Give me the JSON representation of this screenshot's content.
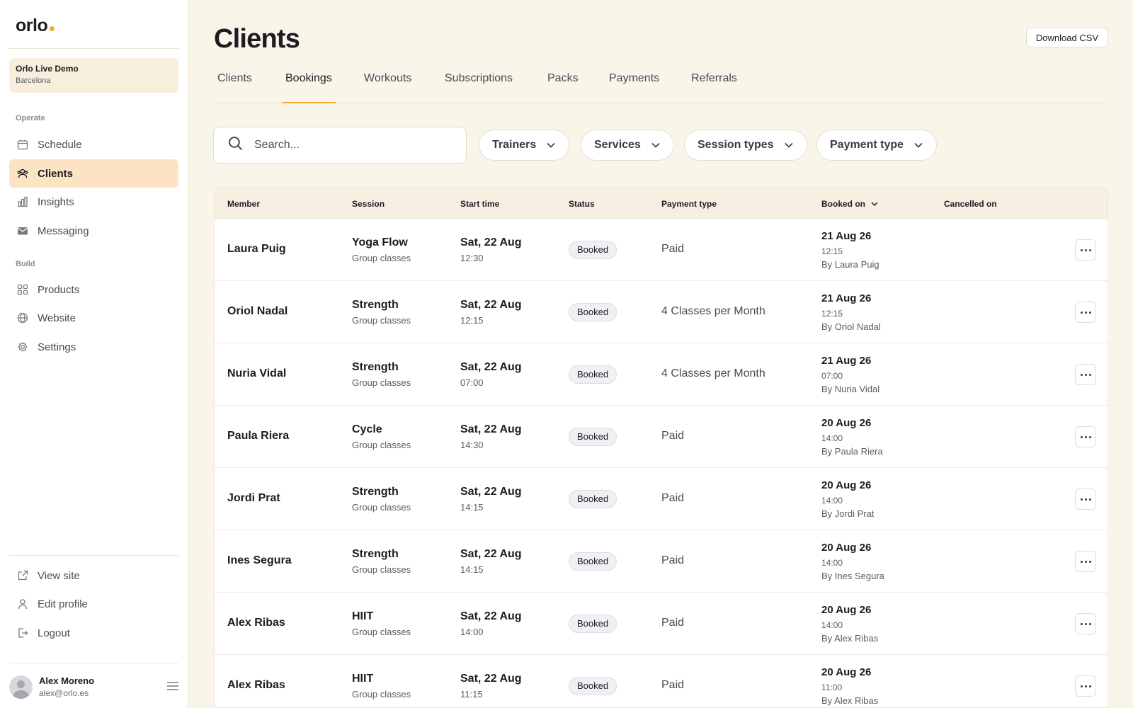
{
  "sidebar": {
    "logo": "orlo",
    "org": {
      "name": "Orlo Live Demo",
      "city": "Barcelona"
    },
    "sections": {
      "operate": "Operate",
      "build": "Build"
    },
    "nav": [
      {
        "label": "Schedule",
        "icon": "calendar-icon"
      },
      {
        "label": "Clients",
        "icon": "users-icon",
        "active": true
      },
      {
        "label": "Insights",
        "icon": "bar-chart-icon"
      },
      {
        "label": "Messaging",
        "icon": "envelope-icon"
      },
      {
        "label": "Products",
        "icon": "grid-icon"
      },
      {
        "label": "Website",
        "icon": "globe-icon"
      },
      {
        "label": "Settings",
        "icon": "gear-icon"
      }
    ],
    "footer": [
      {
        "label": "View site",
        "icon": "external-link-icon"
      },
      {
        "label": "Edit profile",
        "icon": "user-icon"
      },
      {
        "label": "Logout",
        "icon": "logout-icon"
      }
    ],
    "user": {
      "name": "Alex Moreno",
      "email": "alex@orlo.es"
    }
  },
  "header": {
    "title": "Clients",
    "download_label": "Download CSV"
  },
  "tabs": [
    "Clients",
    "Bookings",
    "Workouts",
    "Subscriptions",
    "Packs",
    "Payments",
    "Referrals"
  ],
  "active_tab": "Bookings",
  "search": {
    "placeholder": "Search..."
  },
  "filters": [
    "Trainers",
    "Services",
    "Session types",
    "Payment type"
  ],
  "table": {
    "columns": [
      "Member",
      "Session",
      "Start time",
      "Status",
      "Payment type",
      "Booked on",
      "Cancelled on"
    ],
    "sorted_column": "Booked on",
    "rows": [
      {
        "member": "Laura Puig",
        "session": "Yoga Flow",
        "session_type": "Group classes",
        "start_date": "Sat, 22 Aug",
        "start_time": "12:30",
        "status": "Booked",
        "payment": "Paid",
        "booked_date": "21 Aug 26",
        "booked_time": "12:15",
        "booked_by": "By Laura Puig",
        "cancelled": ""
      },
      {
        "member": "Oriol Nadal",
        "session": "Strength",
        "session_type": "Group classes",
        "start_date": "Sat, 22 Aug",
        "start_time": "12:15",
        "status": "Booked",
        "payment": "4 Classes per Month",
        "booked_date": "21 Aug 26",
        "booked_time": "12:15",
        "booked_by": "By Oriol Nadal",
        "cancelled": ""
      },
      {
        "member": "Nuria Vidal",
        "session": "Strength",
        "session_type": "Group classes",
        "start_date": "Sat, 22 Aug",
        "start_time": "07:00",
        "status": "Booked",
        "payment": "4 Classes per Month",
        "booked_date": "21 Aug 26",
        "booked_time": "07:00",
        "booked_by": "By Nuria Vidal",
        "cancelled": ""
      },
      {
        "member": "Paula Riera",
        "session": "Cycle",
        "session_type": "Group classes",
        "start_date": "Sat, 22 Aug",
        "start_time": "14:30",
        "status": "Booked",
        "payment": "Paid",
        "booked_date": "20 Aug 26",
        "booked_time": "14:00",
        "booked_by": "By Paula Riera",
        "cancelled": ""
      },
      {
        "member": "Jordi Prat",
        "session": "Strength",
        "session_type": "Group classes",
        "start_date": "Sat, 22 Aug",
        "start_time": "14:15",
        "status": "Booked",
        "payment": "Paid",
        "booked_date": "20 Aug 26",
        "booked_time": "14:00",
        "booked_by": "By Jordi Prat",
        "cancelled": ""
      },
      {
        "member": "Ines Segura",
        "session": "Strength",
        "session_type": "Group classes",
        "start_date": "Sat, 22 Aug",
        "start_time": "14:15",
        "status": "Booked",
        "payment": "Paid",
        "booked_date": "20 Aug 26",
        "booked_time": "14:00",
        "booked_by": "By Ines Segura",
        "cancelled": ""
      },
      {
        "member": "Alex Ribas",
        "session": "HIIT",
        "session_type": "Group classes",
        "start_date": "Sat, 22 Aug",
        "start_time": "14:00",
        "status": "Booked",
        "payment": "Paid",
        "booked_date": "20 Aug 26",
        "booked_time": "14:00",
        "booked_by": "By Alex Ribas",
        "cancelled": ""
      },
      {
        "member": "Alex Ribas",
        "session": "HIIT",
        "session_type": "Group classes",
        "start_date": "Sat, 22 Aug",
        "start_time": "11:15",
        "status": "Booked",
        "payment": "Paid",
        "booked_date": "20 Aug 26",
        "booked_time": "11:00",
        "booked_by": "By Alex Ribas",
        "cancelled": ""
      }
    ]
  },
  "colors": {
    "accent": "#f2a93b",
    "background": "#faf5e9",
    "active_nav": "#fbe3c4",
    "header_row": "#f7f0e2"
  }
}
